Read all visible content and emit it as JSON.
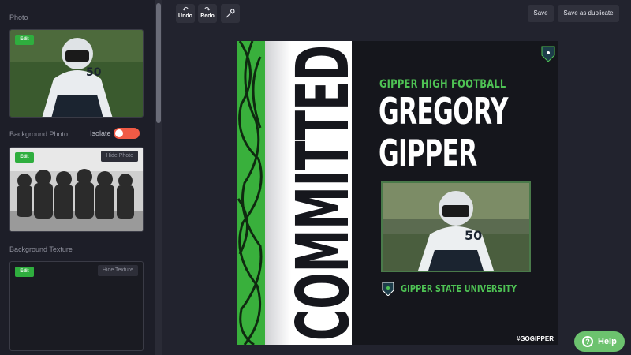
{
  "sidebar": {
    "photo_label": "Photo",
    "photo_edit": "Edit",
    "background_photo_label": "Background Photo",
    "isolate_label": "Isolate",
    "isolate_on": true,
    "bg_edit": "Edit",
    "hide_photo": "Hide Photo",
    "background_texture_label": "Background Texture",
    "texture_edit": "Edit",
    "hide_texture": "Hide Texture"
  },
  "toolbar": {
    "undo": "Undo",
    "redo": "Redo",
    "save": "Save",
    "save_duplicate": "Save as duplicate"
  },
  "poster": {
    "vertical_word": "COMMITTED",
    "school": "GIPPER HIGH FOOTBALL",
    "first_name": "GREGORY",
    "last_name": "GIPPER",
    "university": "GIPPER STATE UNIVERSITY",
    "hashtag": "#GOGIPPER",
    "jersey_number": "50"
  },
  "help": {
    "label": "Help"
  },
  "colors": {
    "accent_green": "#4ec254",
    "toggle": "#f05a45",
    "help": "#6cc26e"
  }
}
